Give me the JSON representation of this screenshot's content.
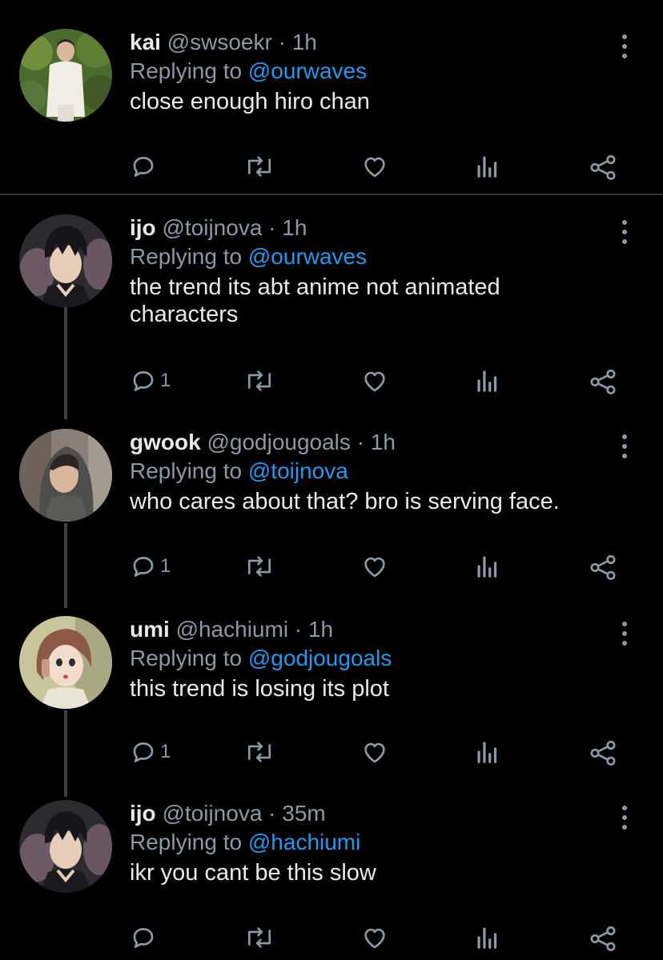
{
  "tweets": [
    {
      "name": "kai",
      "handle": "@swsoekr",
      "dot": "·",
      "time": "1h",
      "replying_prefix": "Replying to ",
      "replying_to": "@ourwaves",
      "text": "close enough hiro chan",
      "reply_count": "",
      "avatar": "photo-person-white-shirt"
    },
    {
      "name": "ijo",
      "handle": "@toijnova",
      "dot": "·",
      "time": "1h",
      "replying_prefix": "Replying to ",
      "replying_to": "@ourwaves",
      "text": "the trend its abt anime not animated characters",
      "reply_count": "1",
      "avatar": "anime-dark-hair"
    },
    {
      "name": "gwook",
      "handle": "@godjougoals",
      "dot": "·",
      "time": "1h",
      "replying_prefix": "Replying to ",
      "replying_to": "@toijnova",
      "text": "who cares about that? bro is serving face.",
      "reply_count": "1",
      "avatar": "photo-person-hoodie"
    },
    {
      "name": "umi",
      "handle": "@hachiumi",
      "dot": "·",
      "time": "1h",
      "replying_prefix": "Replying to ",
      "replying_to": "@godjougoals",
      "text": "this trend is losing its plot",
      "reply_count": "1",
      "avatar": "anime-phone-girl"
    },
    {
      "name": "ijo",
      "handle": "@toijnova",
      "dot": "·",
      "time": "35m",
      "replying_prefix": "Replying to ",
      "replying_to": "@hachiumi",
      "text": "ikr you cant be this slow",
      "reply_count": "",
      "avatar": "anime-dark-hair"
    }
  ],
  "icons": {
    "reply": "reply-icon",
    "retweet": "retweet-icon",
    "like": "heart-icon",
    "views": "views-icon",
    "share": "share-icon",
    "more": "more-icon"
  },
  "colors": {
    "background": "#000000",
    "text": "#e7e9ea",
    "muted": "#8b98a5",
    "link": "#1d9bf0",
    "thread_line": "#3c4045"
  }
}
